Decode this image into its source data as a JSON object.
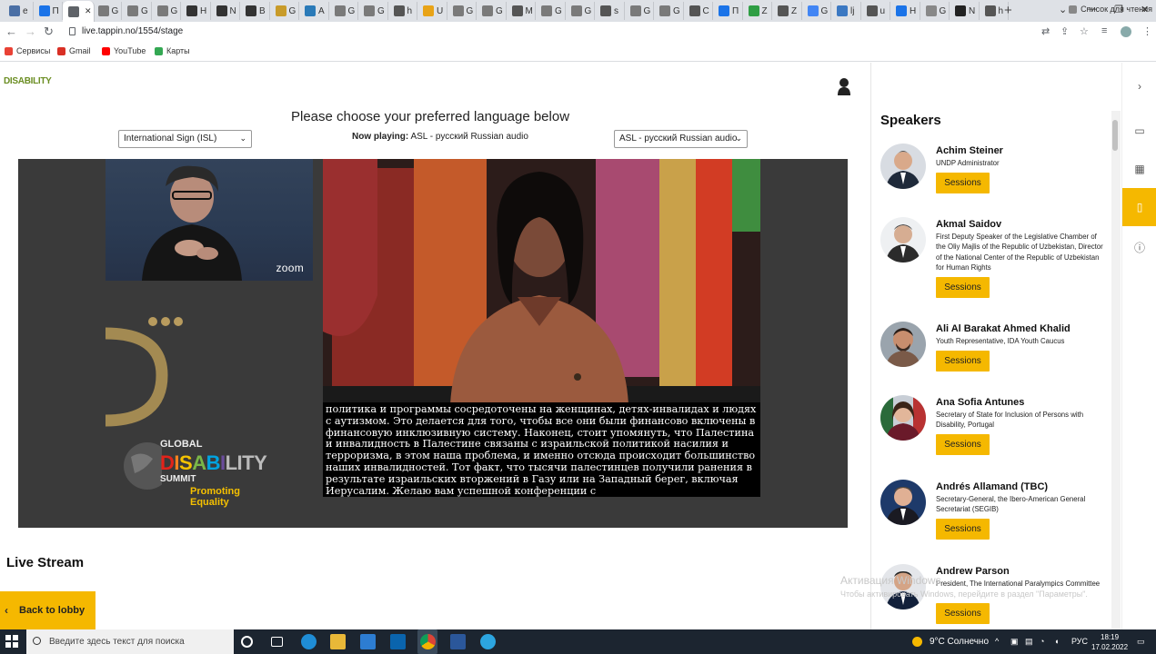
{
  "browser": {
    "tabs": [
      {
        "label": "e",
        "color": "#4a6fa5"
      },
      {
        "label": "П",
        "color": "#1a73e8"
      },
      {
        "label": "",
        "color": "#5f6368",
        "active": true
      },
      {
        "label": "G",
        "color": "#7a7a7a"
      },
      {
        "label": "G",
        "color": "#7a7a7a"
      },
      {
        "label": "G",
        "color": "#7a7a7a"
      },
      {
        "label": "H",
        "color": "#333333"
      },
      {
        "label": "N",
        "color": "#333333"
      },
      {
        "label": "B",
        "color": "#333333"
      },
      {
        "label": "G",
        "color": "#c89b2a"
      },
      {
        "label": "A",
        "color": "#2a7ab8"
      },
      {
        "label": "G",
        "color": "#7a7a7a"
      },
      {
        "label": "G",
        "color": "#7a7a7a"
      },
      {
        "label": "h",
        "color": "#555555"
      },
      {
        "label": "U",
        "color": "#e8a317"
      },
      {
        "label": "G",
        "color": "#7a7a7a"
      },
      {
        "label": "G",
        "color": "#7a7a7a"
      },
      {
        "label": "M",
        "color": "#555555"
      },
      {
        "label": "G",
        "color": "#7a7a7a"
      },
      {
        "label": "G",
        "color": "#7a7a7a"
      },
      {
        "label": "s",
        "color": "#555555"
      },
      {
        "label": "G",
        "color": "#7a7a7a"
      },
      {
        "label": "G",
        "color": "#7a7a7a"
      },
      {
        "label": "C",
        "color": "#555555"
      },
      {
        "label": "П",
        "color": "#1a73e8"
      },
      {
        "label": "Z",
        "color": "#2f9e44"
      },
      {
        "label": "Z",
        "color": "#555555"
      },
      {
        "label": "G",
        "color": "#4285f4"
      },
      {
        "label": "lj",
        "color": "#3b78c2"
      },
      {
        "label": "u",
        "color": "#555555"
      },
      {
        "label": "H",
        "color": "#1a73e8"
      },
      {
        "label": "G",
        "color": "#888888"
      },
      {
        "label": "N",
        "color": "#222222"
      },
      {
        "label": "h",
        "color": "#555555"
      }
    ],
    "new_tab": "+",
    "url": "live.tappin.no/1554/stage",
    "bookmarks": [
      {
        "label": "Сервисы",
        "color": "#e94235"
      },
      {
        "label": "Gmail",
        "color": "#d93025"
      },
      {
        "label": "YouTube",
        "color": "#ff0000"
      },
      {
        "label": "Карты",
        "color": "#34a853"
      }
    ],
    "reading_list": "Список для чтения"
  },
  "page": {
    "logo_text": "DISABILITY",
    "language_title": "Please choose your preferred language below",
    "left_select": "International Sign (ISL)",
    "right_select": "ASL - русский Russian audio",
    "now_playing_label": "Now playing:",
    "now_playing_value": "ASL - русский Russian audio",
    "zoom_label": "zoom",
    "captions": "политика и программы сосредоточены на женщинах, детях-инвалидах и людях с аутизмом. Это делается для того, чтобы все они были финансово включены в финансовую инклюзивную систему. Наконец, стоит упомянуть, что Палестина и инвалидность в Палестине связаны с израильской политикой насилия и терроризма, в этом наша проблема, и именно отсюда происходит большинство наших инвалидностей. Тот факт, что тысячи палестинцев получили ранения в результате израильских вторжений в Газу или на Западный берег, включая Иерусалим. Желаю вам успешной конференции с",
    "summit_logo": {
      "global": "GLOBAL",
      "disability": "DISABILITY",
      "summit": "SUMMIT",
      "promoting": "Promoting Equality"
    },
    "live_stream_heading": "Live Stream",
    "back_button": "Back to lobby"
  },
  "speakers": {
    "title": "Speakers",
    "button_label": "Sessions",
    "items": [
      {
        "name": "Achim Steiner",
        "role": "UNDP Administrator"
      },
      {
        "name": "Akmal Saidov",
        "role": "First Deputy Speaker of the Legislative Chamber of the Oliy Majlis of the Republic of Uzbekistan, Director of the National Center of the Republic of Uzbekistan for Human Rights"
      },
      {
        "name": "Ali Al Barakat Ahmed Khalid",
        "role": "Youth Representative, IDA Youth Caucus"
      },
      {
        "name": "Ana Sofia Antunes",
        "role": "Secretary of State for Inclusion of Persons with Disability, Portugal"
      },
      {
        "name": "Andrés Allamand (TBC)",
        "role": "Secretary-General, the Ibero-American General Secretariat (SEGIB)"
      },
      {
        "name": "Andrew Parson",
        "role": "President, The International Paralympics Committee"
      }
    ]
  },
  "watermark": {
    "line1": "Активация Windows",
    "line2": "Чтобы активировать Windows, перейдите в раздел \"Параметры\"."
  },
  "taskbar": {
    "search_placeholder": "Введите здесь текст для поиска",
    "weather": "9°C  Солнечно",
    "lang": "РУС",
    "time": "18:19",
    "date": "17.02.2022"
  },
  "colors": {
    "accent": "#f5b800",
    "stage_bg": "#3a3a3a"
  }
}
